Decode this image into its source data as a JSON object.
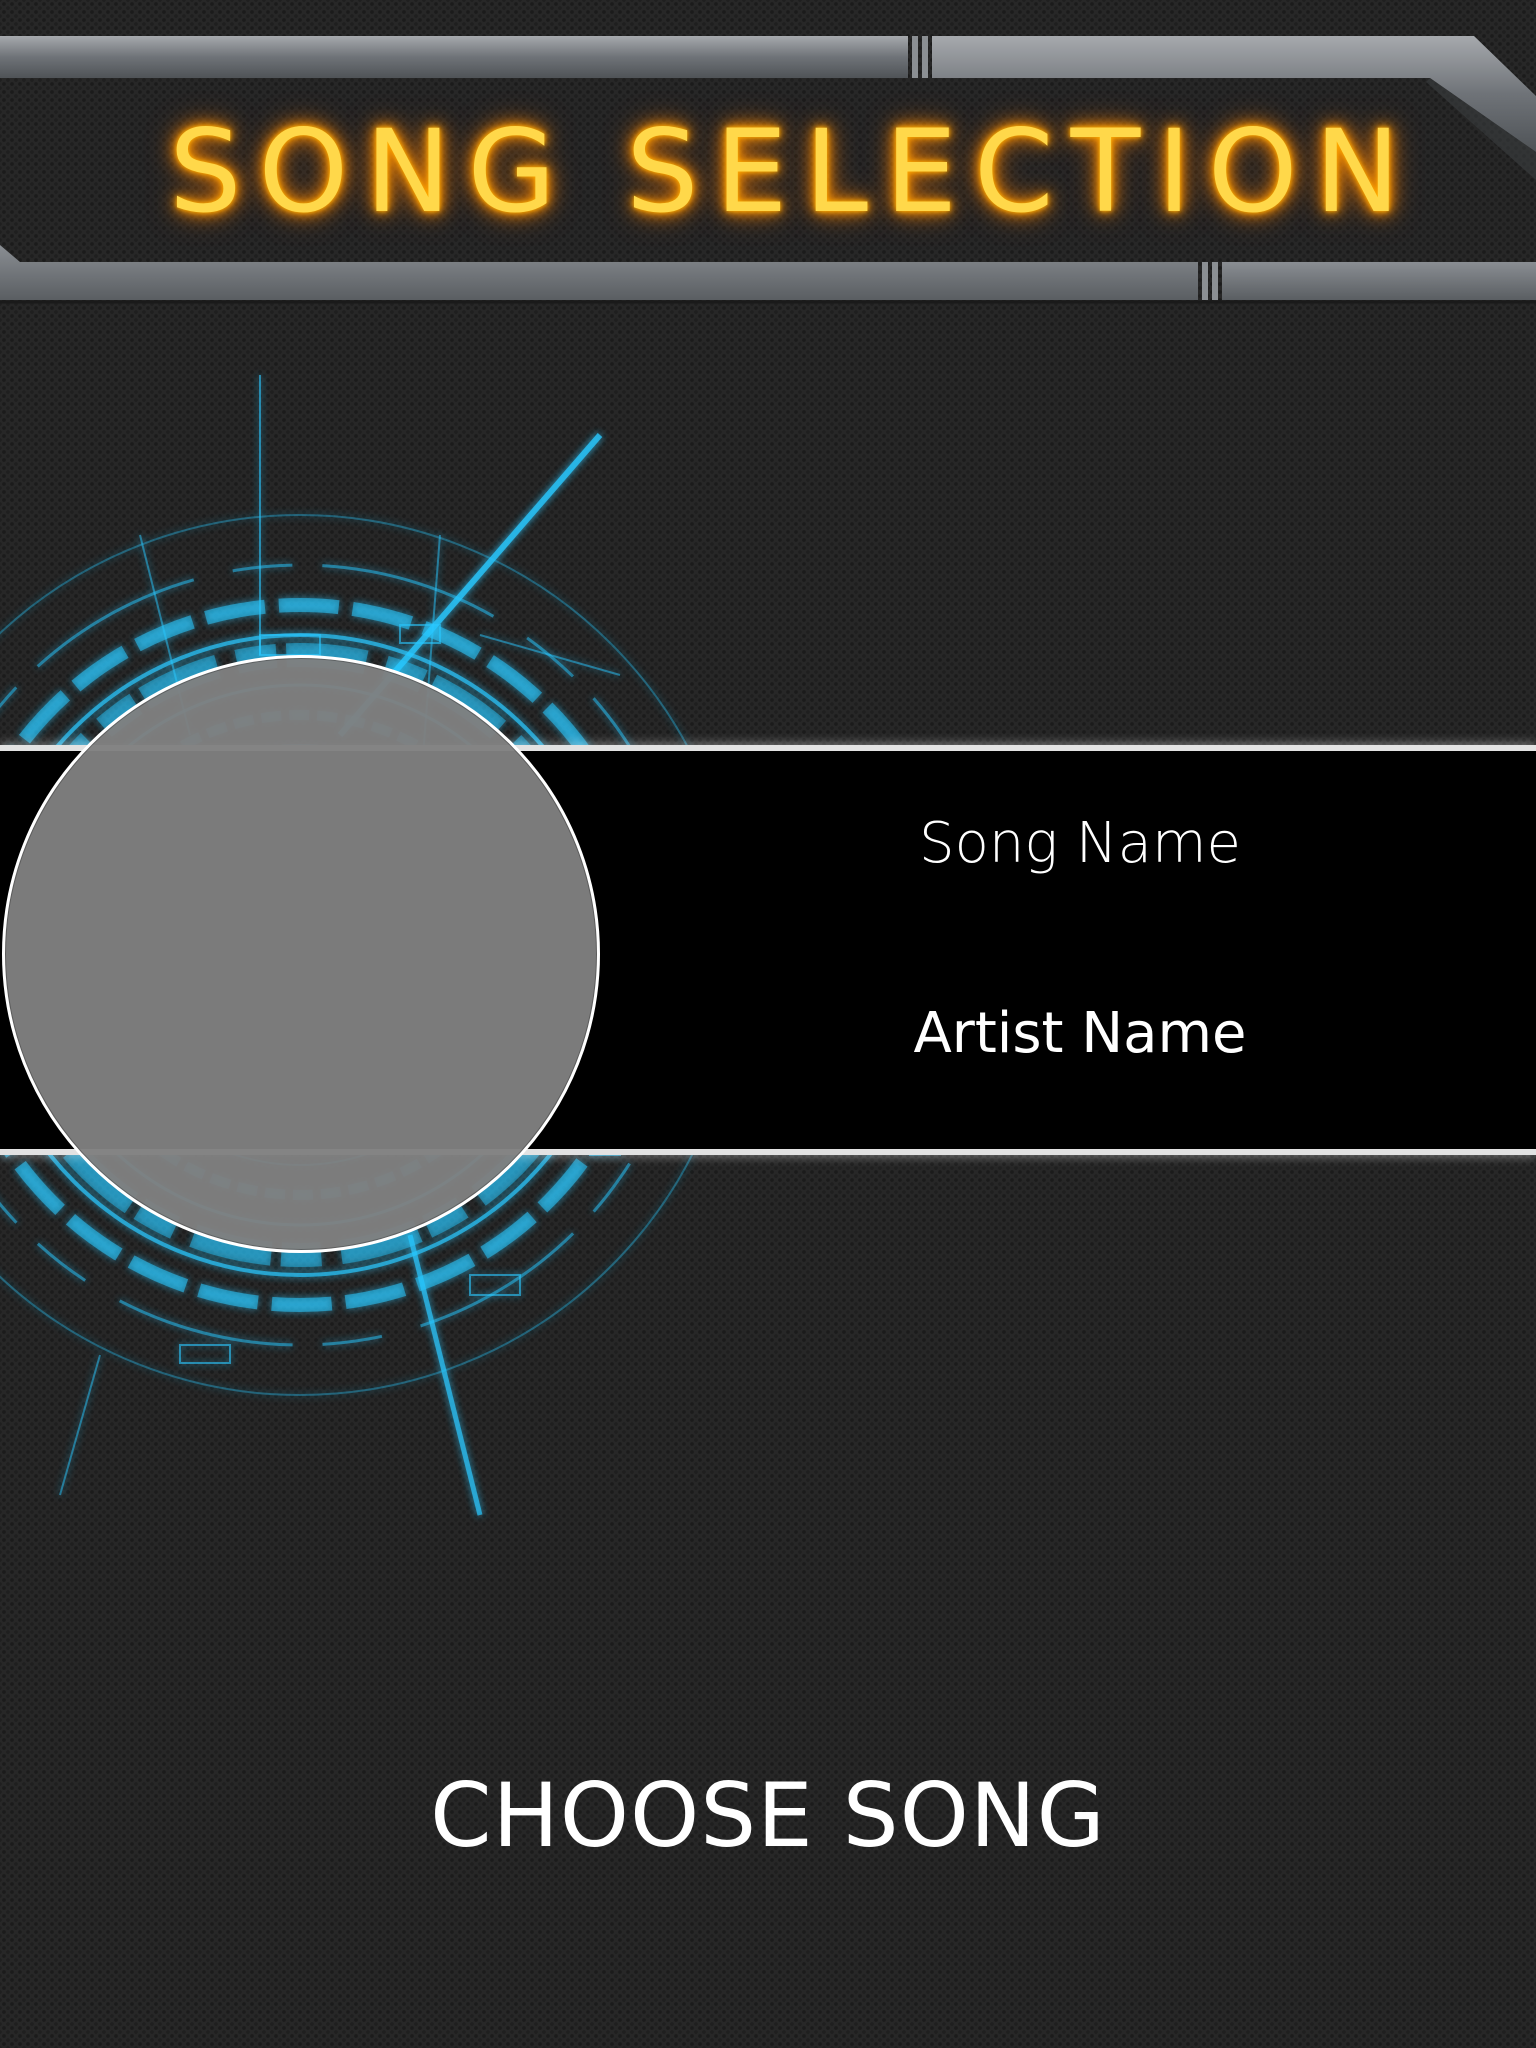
{
  "header": {
    "title": "SONG SELECTION"
  },
  "now_selected": {
    "song_name": "Song Name",
    "artist_name": "Artist Name"
  },
  "actions": {
    "choose_song_label": "CHOOSE SONG"
  },
  "colors": {
    "background": "#272727",
    "title_glow": "#ffd84a",
    "hud_accent": "#29c8ff",
    "band": "#000000",
    "album_placeholder": "#808080"
  },
  "icons": {
    "emblem": "hud-circle-emblem"
  }
}
